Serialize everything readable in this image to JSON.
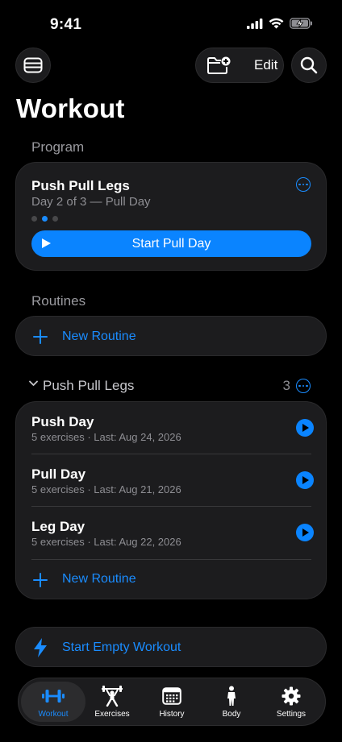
{
  "status_bar": {
    "time": "9:41"
  },
  "header": {
    "title": "Workout",
    "edit_label": "Edit"
  },
  "program_section": {
    "label": "Program",
    "program_name": "Push Pull Legs",
    "progress_text": "Day 2 of 3 — Pull Day",
    "current_day": 2,
    "total_days": 3,
    "start_label": "Start Pull Day"
  },
  "routines_section": {
    "label": "Routines",
    "new_routine_label": "New Routine"
  },
  "group": {
    "name": "Push Pull Legs",
    "count": "3",
    "routines": [
      {
        "name": "Push Day",
        "meta": "5 exercises · Last: Aug 24, 2026"
      },
      {
        "name": "Pull Day",
        "meta": "5 exercises · Last: Aug 21, 2026"
      },
      {
        "name": "Leg Day",
        "meta": "5 exercises · Last: Aug 22, 2026"
      }
    ],
    "new_routine_label": "New Routine"
  },
  "empty_workout": {
    "label": "Start Empty Workout"
  },
  "tab_bar": {
    "tabs": [
      {
        "label": "Workout",
        "icon": "dumbbell-icon",
        "active": true
      },
      {
        "label": "Exercises",
        "icon": "weightlifter-icon",
        "active": false
      },
      {
        "label": "History",
        "icon": "calendar-icon",
        "active": false
      },
      {
        "label": "Body",
        "icon": "person-icon",
        "active": false
      },
      {
        "label": "Settings",
        "icon": "gear-icon",
        "active": false
      }
    ]
  },
  "colors": {
    "accent": "#0a84ff",
    "background": "#000000",
    "card": "#1c1c1e",
    "secondary_text": "#8e8e93"
  }
}
